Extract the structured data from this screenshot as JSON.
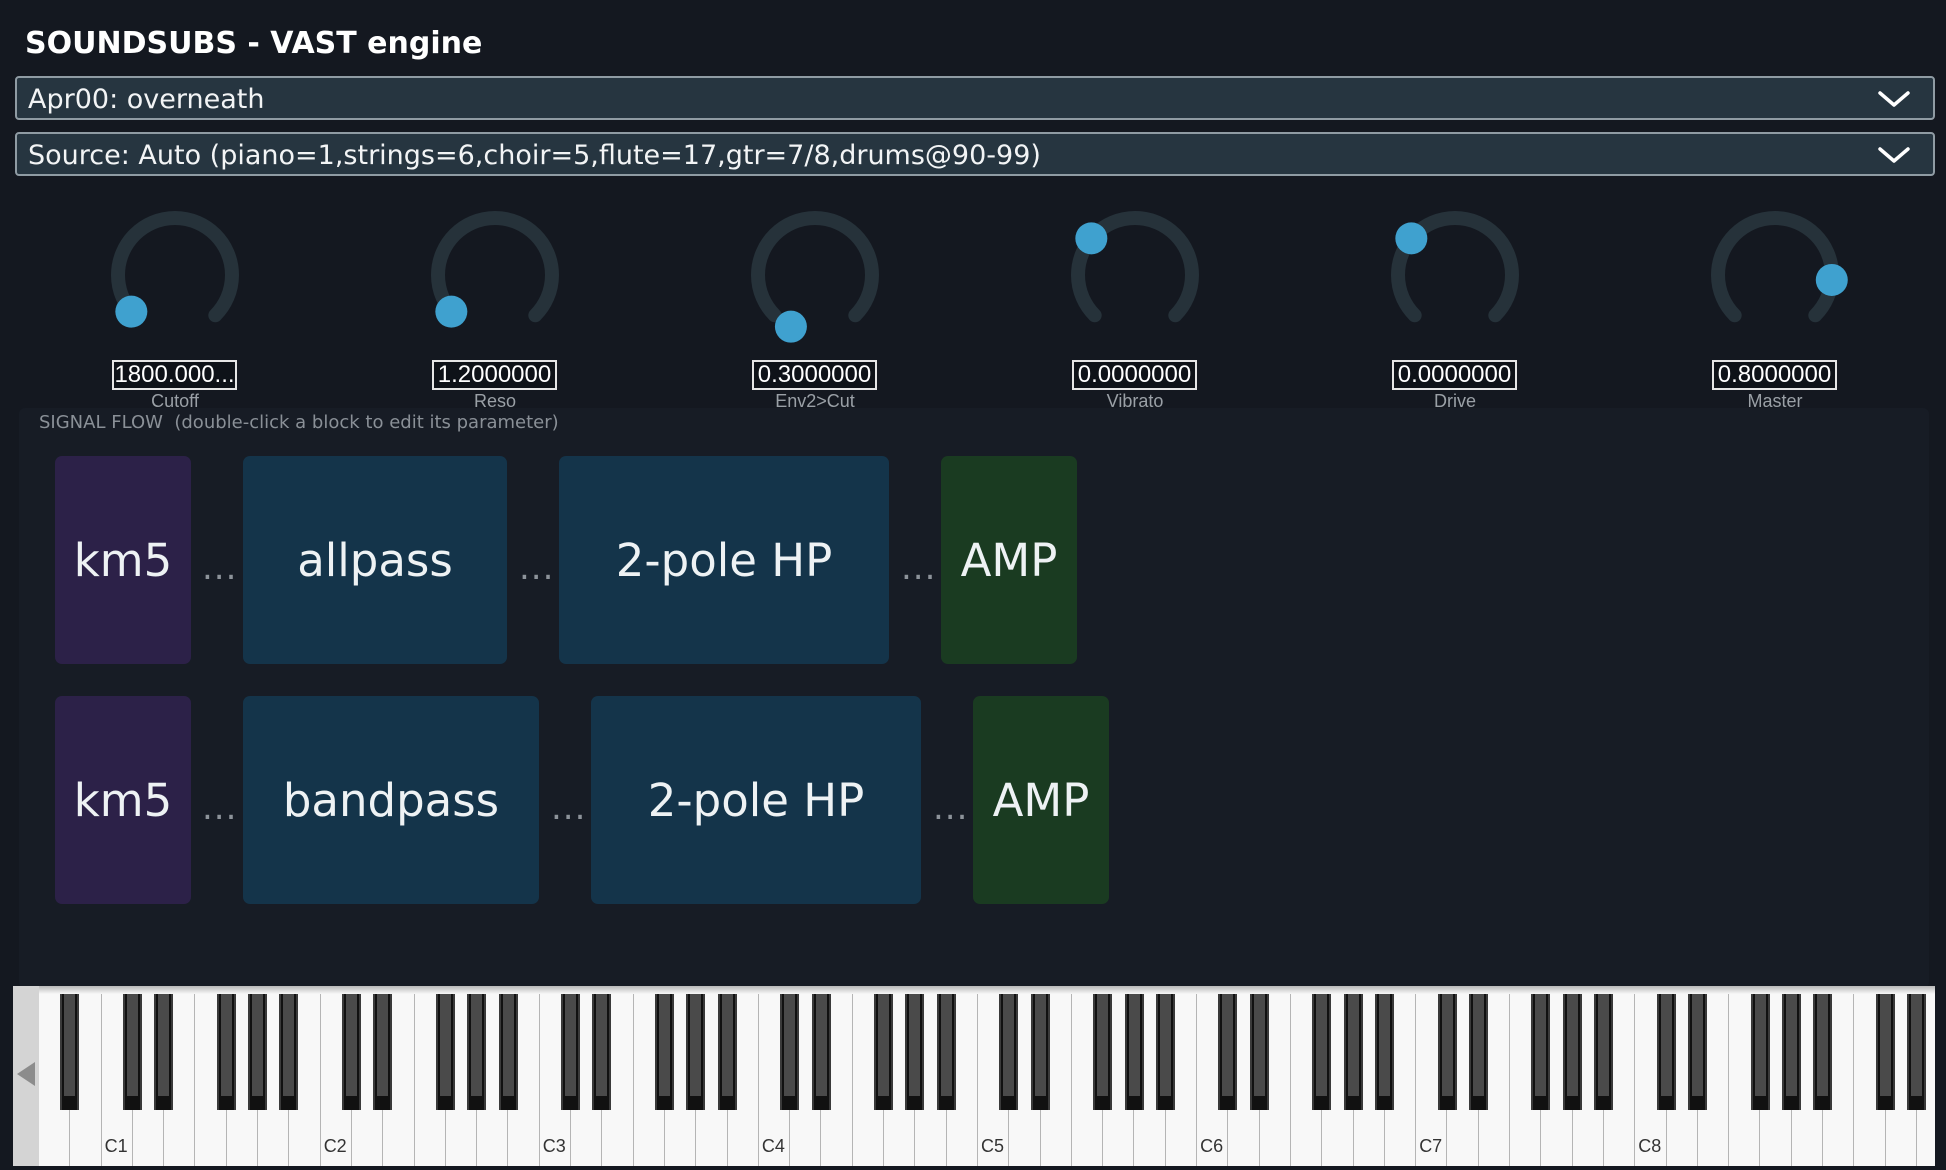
{
  "app": {
    "title": "SOUNDSUBS - VAST engine"
  },
  "preset_select": {
    "value": "Apr00: overneath"
  },
  "source_select": {
    "value": "Source: Auto (piano=1,strings=6,choir=5,flute=17,gtr=7/8,drums@90-99)"
  },
  "knobs": [
    {
      "label": "Cutoff",
      "value": "1800.000...",
      "dot_angle_deg": 220
    },
    {
      "label": "Reso",
      "value": "1.2000000",
      "dot_angle_deg": 220
    },
    {
      "label": "Env2>Cut",
      "value": "0.3000000",
      "dot_angle_deg": 245
    },
    {
      "label": "Vibrato",
      "value": "0.0000000",
      "dot_angle_deg": 140
    },
    {
      "label": "Drive",
      "value": "0.0000000",
      "dot_angle_deg": 140
    },
    {
      "label": "Master",
      "value": "0.8000000",
      "dot_angle_deg": 355
    }
  ],
  "signal_flow": {
    "label": "SIGNAL FLOW  (double-click a block to edit its parameter)",
    "separator": "...",
    "rows": [
      {
        "blocks": [
          {
            "label": "km5",
            "kind": "osc"
          },
          {
            "label": "allpass",
            "kind": "filter"
          },
          {
            "label": "2-pole HP",
            "kind": "filter"
          },
          {
            "label": "AMP",
            "kind": "amp"
          }
        ]
      },
      {
        "blocks": [
          {
            "label": "km5",
            "kind": "osc"
          },
          {
            "label": "bandpass",
            "kind": "filter"
          },
          {
            "label": "2-pole HP",
            "kind": "filter"
          },
          {
            "label": "AMP",
            "kind": "amp"
          }
        ]
      }
    ]
  },
  "keyboard": {
    "octave_labels": [
      "C1",
      "C2",
      "C3",
      "C4",
      "C5",
      "C6",
      "C7",
      "C8"
    ]
  },
  "colors": {
    "background": "#141820",
    "accent": "#3fa1cf",
    "osc_block": "#2c2148",
    "filter_block": "#14344a",
    "amp_block": "#1a3b21"
  },
  "icons": {
    "dropdown": "chevron-down-icon",
    "keyboard_scroll": "triangle-left-icon"
  }
}
